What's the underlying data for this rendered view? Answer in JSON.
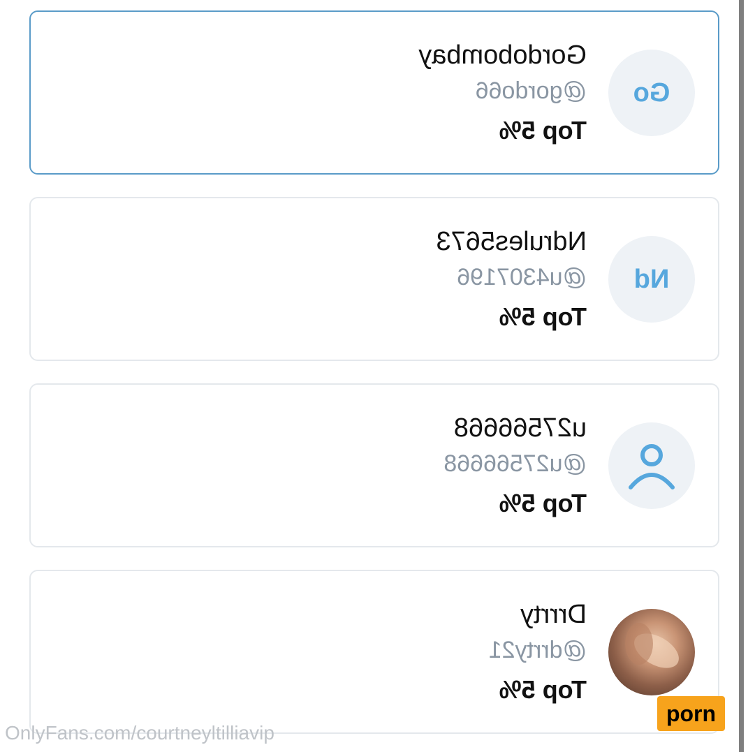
{
  "users": [
    {
      "name": "Gordobombay",
      "handle": "@gordo66",
      "rank": "Top 5%",
      "initials": "Go",
      "avatar_type": "initials",
      "selected": true
    },
    {
      "name": "Ndrules5673",
      "handle": "@u4307196",
      "rank": "Top 5%",
      "initials": "Nd",
      "avatar_type": "initials",
      "selected": false
    },
    {
      "name": "u27566668",
      "handle": "@u27566668",
      "rank": "Top 5%",
      "initials": "",
      "avatar_type": "user-icon",
      "selected": false
    },
    {
      "name": "Drrrty",
      "handle": "@drrty21",
      "rank": "Top 5%",
      "initials": "",
      "avatar_type": "photo",
      "selected": false
    }
  ],
  "watermark": "OnlyFans.com/courtneyltilliavip",
  "badge": "porn",
  "colors": {
    "accent": "#56a7dd",
    "selected_border": "#5a9bc8",
    "badge_bg": "#f7a31c"
  }
}
